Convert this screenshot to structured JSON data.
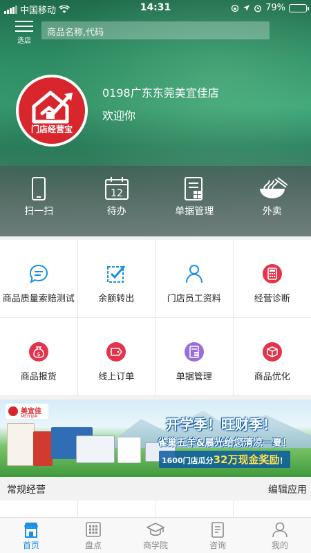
{
  "status_bar": {
    "carrier": "中国移动",
    "time": "14:31",
    "battery_text": "79%",
    "battery_level": 0.79
  },
  "top_nav": {
    "menu_label": "选店",
    "search_placeholder": "商品名称,代码"
  },
  "store": {
    "logo_text": "门店经营宝",
    "name": "0198广东东莞美宜佳店",
    "welcome": "欢迎你"
  },
  "quick_actions": [
    {
      "label": "扫一扫",
      "icon": "phone-scan-icon"
    },
    {
      "label": "待办",
      "icon": "calendar-icon",
      "badge": "12"
    },
    {
      "label": "单据管理",
      "icon": "document-grid-icon"
    },
    {
      "label": "外卖",
      "icon": "noodle-bowl-icon"
    }
  ],
  "grid": [
    {
      "label": "商品质量索赔测试",
      "icon": "chat-bubble-icon",
      "color": "#1a8fe3"
    },
    {
      "label": "余额转出",
      "icon": "checkbox-icon",
      "color": "#1a8fe3"
    },
    {
      "label": "门店员工资料",
      "icon": "person-icon",
      "color": "#1a8fe3"
    },
    {
      "label": "经营诊断",
      "icon": "calculator-icon",
      "color": "#e5334b"
    },
    {
      "label": "商品报货",
      "icon": "money-bag-icon",
      "color": "#e5334b"
    },
    {
      "label": "线上订单",
      "icon": "tag-icon",
      "color": "#e5334b"
    },
    {
      "label": "单据管理",
      "icon": "document-icon",
      "color": "#9b6fd9"
    },
    {
      "label": "商品优化",
      "icon": "box-icon",
      "color": "#e5334b"
    }
  ],
  "banner": {
    "brand": "美宜佳",
    "brand_en": "MEIYIJIA",
    "headline": "开学季！旺财季！",
    "subline": "雀巢五羊&晨光给您清凉一夏！",
    "prize_prefix": "1600门店瓜分",
    "prize_amount": "32万现金奖励",
    "prize_suffix": "！"
  },
  "section": {
    "title": "常规经营",
    "edit_label": "编辑应用"
  },
  "tabs": [
    {
      "label": "首页",
      "icon": "home-store-icon",
      "active": true
    },
    {
      "label": "盘点",
      "icon": "grid-app-icon",
      "active": false
    },
    {
      "label": "商学院",
      "icon": "graduation-cap-icon",
      "active": false
    },
    {
      "label": "咨询",
      "icon": "notepad-icon",
      "active": false
    },
    {
      "label": "我的",
      "icon": "user-icon",
      "active": false
    }
  ],
  "colors": {
    "accent": "#1a8fe3",
    "brand_red": "#d9262c"
  }
}
